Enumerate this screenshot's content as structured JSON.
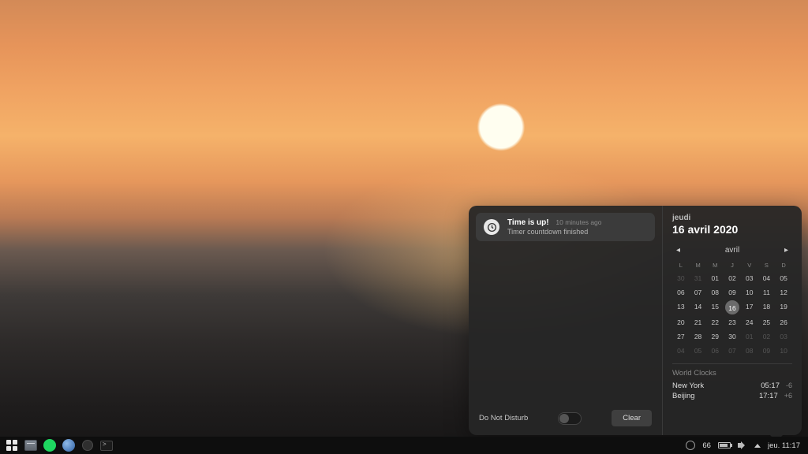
{
  "notification": {
    "title": "Time is up!",
    "when": "10 minutes ago",
    "body": "Timer countdown finished"
  },
  "dnd": {
    "label": "Do Not Disturb",
    "enabled": false
  },
  "clear_label": "Clear",
  "date": {
    "weekday": "jeudi",
    "full": "16 avril 2020"
  },
  "calendar": {
    "month_label": "avril",
    "day_headers": [
      "L",
      "M",
      "M",
      "J",
      "V",
      "S",
      "D"
    ],
    "weeks": [
      [
        {
          "n": "30",
          "other": true
        },
        {
          "n": "31",
          "other": true
        },
        {
          "n": "01"
        },
        {
          "n": "02"
        },
        {
          "n": "03"
        },
        {
          "n": "04"
        },
        {
          "n": "05"
        }
      ],
      [
        {
          "n": "06"
        },
        {
          "n": "07"
        },
        {
          "n": "08"
        },
        {
          "n": "09"
        },
        {
          "n": "10"
        },
        {
          "n": "11"
        },
        {
          "n": "12"
        }
      ],
      [
        {
          "n": "13"
        },
        {
          "n": "14"
        },
        {
          "n": "15"
        },
        {
          "n": "16",
          "today": true
        },
        {
          "n": "17"
        },
        {
          "n": "18"
        },
        {
          "n": "19"
        }
      ],
      [
        {
          "n": "20"
        },
        {
          "n": "21"
        },
        {
          "n": "22"
        },
        {
          "n": "23"
        },
        {
          "n": "24"
        },
        {
          "n": "25"
        },
        {
          "n": "26"
        }
      ],
      [
        {
          "n": "27"
        },
        {
          "n": "28"
        },
        {
          "n": "29"
        },
        {
          "n": "30"
        },
        {
          "n": "01",
          "other": true
        },
        {
          "n": "02",
          "other": true
        },
        {
          "n": "03",
          "other": true
        }
      ],
      [
        {
          "n": "04",
          "other": true
        },
        {
          "n": "05",
          "other": true
        },
        {
          "n": "06",
          "other": true
        },
        {
          "n": "07",
          "other": true
        },
        {
          "n": "08",
          "other": true
        },
        {
          "n": "09",
          "other": true
        },
        {
          "n": "10",
          "other": true
        }
      ]
    ]
  },
  "world_clocks": {
    "title": "World Clocks",
    "items": [
      {
        "city": "New York",
        "time": "05:17",
        "offset": "-6"
      },
      {
        "city": "Beijing",
        "time": "17:17",
        "offset": "+6"
      }
    ]
  },
  "taskbar": {
    "battery": "66",
    "clock": "jeu. 11:17"
  }
}
